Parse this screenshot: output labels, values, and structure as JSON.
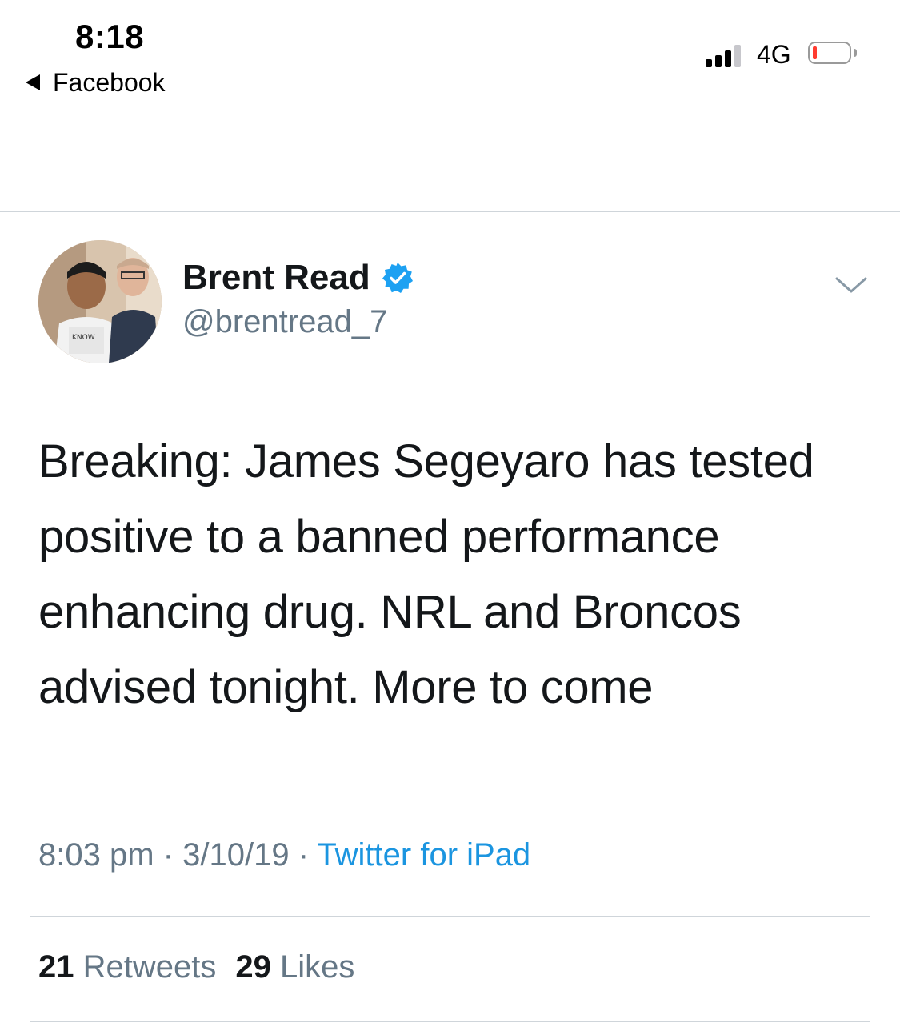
{
  "status_bar": {
    "time": "8:18",
    "back_label": "Facebook",
    "network": "4G",
    "signal_bars": 3,
    "battery_color": "#ff3b30"
  },
  "tweet": {
    "display_name": "Brent Read",
    "username": "@brentread_7",
    "verified": true,
    "text": "Breaking: James Segeyaro has tested positive to a banned performance enhancing drug. NRL and Broncos advised tonight. More to come",
    "time": "8:03 pm",
    "separator": "·",
    "date": "3/10/19",
    "source": "Twitter for iPad",
    "retweets_count": "21",
    "retweets_label": "Retweets",
    "likes_count": "29",
    "likes_label": "Likes"
  },
  "colors": {
    "link": "#1b95e0",
    "secondary_text": "#657786",
    "verified_badge": "#1da1f2"
  }
}
